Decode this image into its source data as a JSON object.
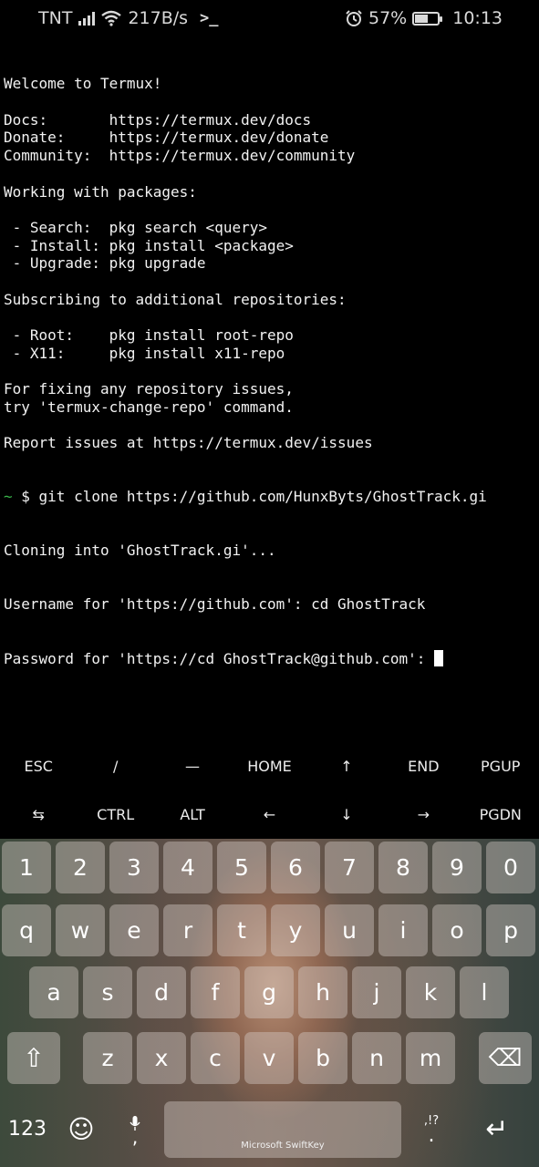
{
  "status_bar": {
    "carrier": "TNT",
    "net_speed": "217B/s",
    "terminal_glyph": ">_",
    "battery": "57%",
    "battery_level": 0.57,
    "time": "10:13",
    "icons": [
      "signal-icon",
      "wifi-icon",
      "termux-icon",
      "alarm-icon",
      "battery-icon"
    ]
  },
  "terminal": {
    "lines": [
      "Welcome to Termux!",
      "",
      "Docs:       https://termux.dev/docs",
      "Donate:     https://termux.dev/donate",
      "Community:  https://termux.dev/community",
      "",
      "Working with packages:",
      "",
      " - Search:  pkg search <query>",
      " - Install: pkg install <package>",
      " - Upgrade: pkg upgrade",
      "",
      "Subscribing to additional repositories:",
      "",
      " - Root:    pkg install root-repo",
      " - X11:     pkg install x11-repo",
      "",
      "For fixing any repository issues,",
      "try 'termux-change-repo' command.",
      "",
      "Report issues at https://termux.dev/issues"
    ],
    "prompt_tilde": "~",
    "prompt_command": " $ git clone https://github.com/HunxByts/GhostTrack.gi",
    "line_cloning": "Cloning into 'GhostTrack.gi'...",
    "line_username": "Username for 'https://github.com': cd GhostTrack",
    "line_password": "Password for 'https://cd GhostTrack@github.com': "
  },
  "extra_keys": {
    "row1": [
      "ESC",
      "/",
      "—",
      "HOME",
      "↑",
      "END",
      "PGUP"
    ],
    "row2": [
      "⇆",
      "CTRL",
      "ALT",
      "←",
      "↓",
      "→",
      "PGDN"
    ]
  },
  "keyboard": {
    "numbers": [
      "1",
      "2",
      "3",
      "4",
      "5",
      "6",
      "7",
      "8",
      "9",
      "0"
    ],
    "row_q": [
      "q",
      "w",
      "e",
      "r",
      "t",
      "y",
      "u",
      "i",
      "o",
      "p"
    ],
    "row_a": [
      "a",
      "s",
      "d",
      "f",
      "g",
      "h",
      "j",
      "k",
      "l"
    ],
    "row_z": [
      "z",
      "x",
      "c",
      "v",
      "b",
      "n",
      "m"
    ],
    "shift": "⇧",
    "backspace": "⌫",
    "symbols": "123",
    "emoji": "☺",
    "mic_comma": ",",
    "space_label": "Microsoft SwiftKey",
    "punct_top": ",!?",
    "period": ".",
    "enter": "↵"
  }
}
